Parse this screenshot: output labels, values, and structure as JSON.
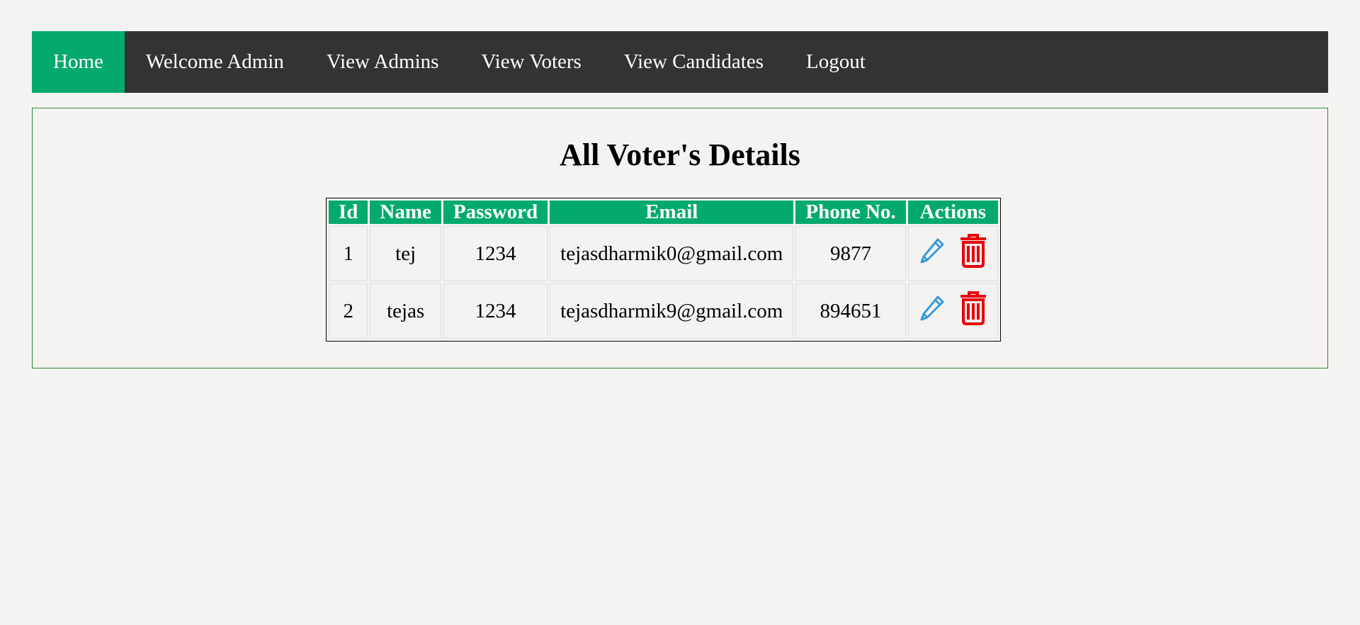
{
  "nav": {
    "items": [
      {
        "label": "Home",
        "active": true
      },
      {
        "label": "Welcome Admin",
        "active": false
      },
      {
        "label": "View Admins",
        "active": false
      },
      {
        "label": "View Voters",
        "active": false
      },
      {
        "label": "View Candidates",
        "active": false
      },
      {
        "label": "Logout",
        "active": false
      }
    ]
  },
  "main": {
    "title": "All Voter's Details",
    "table": {
      "headers": [
        "Id",
        "Name",
        "Password",
        "Email",
        "Phone No.",
        "Actions"
      ],
      "rows": [
        {
          "id": "1",
          "name": "tej",
          "password": "1234",
          "email": "tejasdharmik0@gmail.com",
          "phone": "9877"
        },
        {
          "id": "2",
          "name": "tejas",
          "password": "1234",
          "email": "tejasdharmik9@gmail.com",
          "phone": "894651"
        }
      ]
    }
  },
  "icons": {
    "edit": "pencil-icon",
    "delete": "trash-icon"
  },
  "colors": {
    "accent": "#04aa6d",
    "navbar_bg": "#333333",
    "edit_icon": "#3a9ad9",
    "delete_icon": "#e8000b",
    "content_border": "#2e8b2e"
  }
}
